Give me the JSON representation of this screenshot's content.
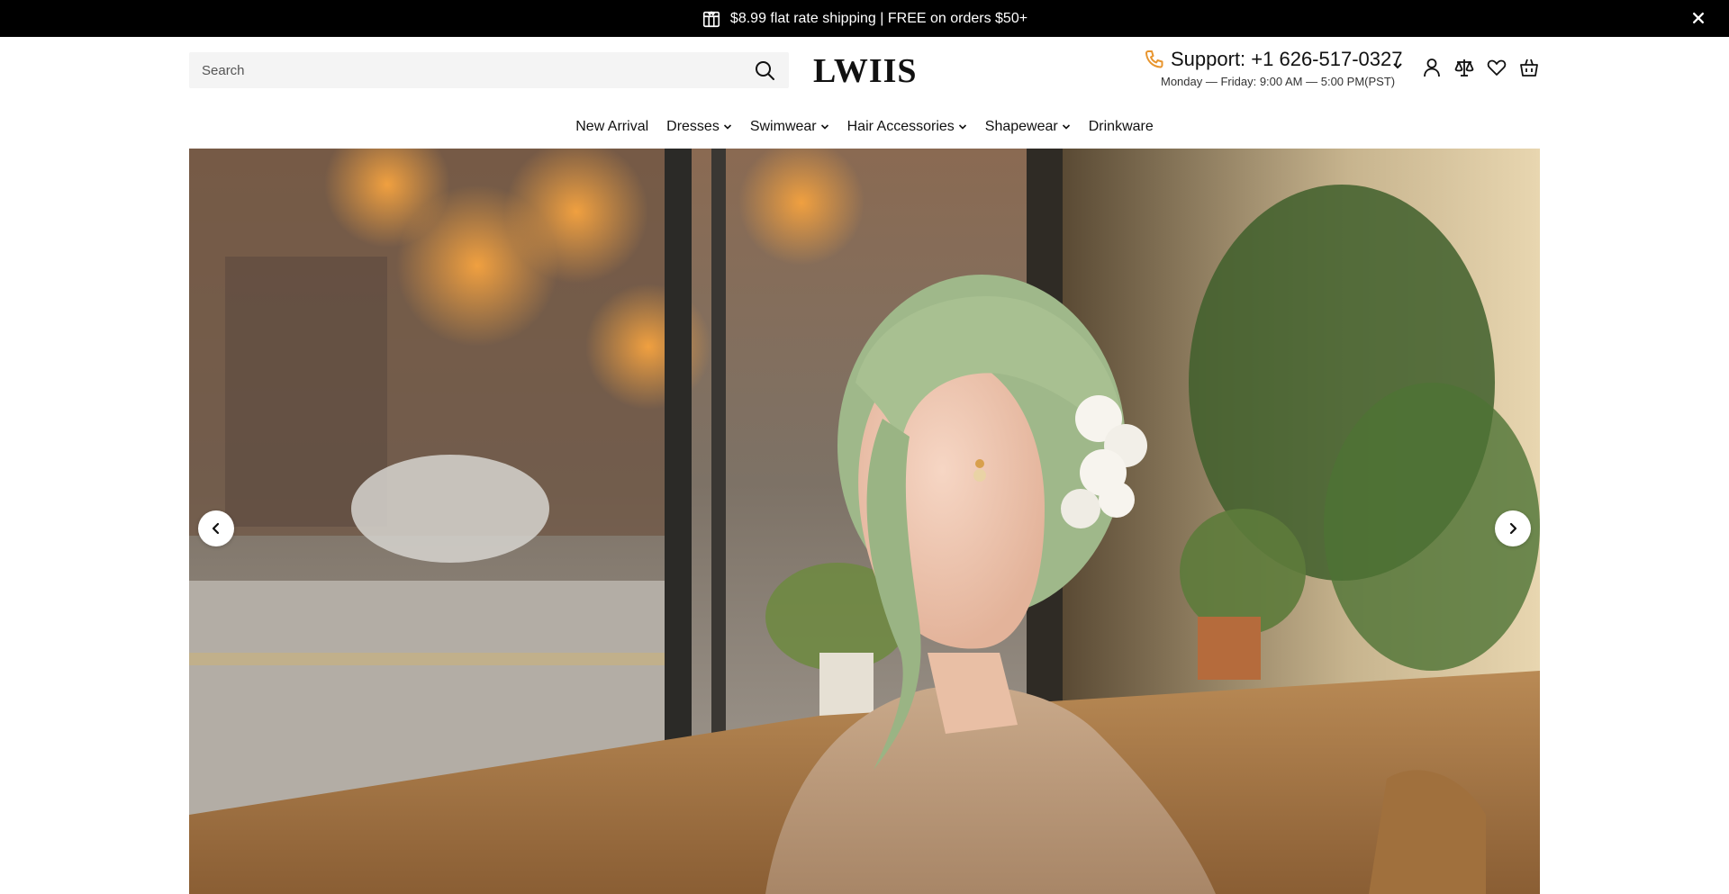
{
  "announcement": {
    "text": "$8.99 flat rate shipping | FREE on orders $50+",
    "icon": "gift-icon",
    "close_icon": "close-icon"
  },
  "header": {
    "search": {
      "placeholder": "Search",
      "value": ""
    },
    "logo": "LWIIS",
    "support": {
      "label": "Support: +1 626-517-0327",
      "hours": "Monday — Friday: 9:00 AM — 5:00 PM(PST)"
    },
    "icons": [
      "account-icon",
      "compare-icon",
      "wishlist-icon",
      "cart-icon"
    ]
  },
  "nav": {
    "items": [
      {
        "label": "New Arrival",
        "has_dropdown": false
      },
      {
        "label": "Dresses",
        "has_dropdown": true
      },
      {
        "label": "Swimwear",
        "has_dropdown": true
      },
      {
        "label": "Hair Accessories",
        "has_dropdown": true
      },
      {
        "label": "Shapewear",
        "has_dropdown": true
      },
      {
        "label": "Drinkware",
        "has_dropdown": false
      }
    ]
  },
  "hero": {
    "prev_icon": "chevron-left-icon",
    "next_icon": "chevron-right-icon"
  },
  "colors": {
    "announcement_bg": "#000000",
    "phone_icon": "#e8952e",
    "search_bg": "#f4f4f4"
  }
}
